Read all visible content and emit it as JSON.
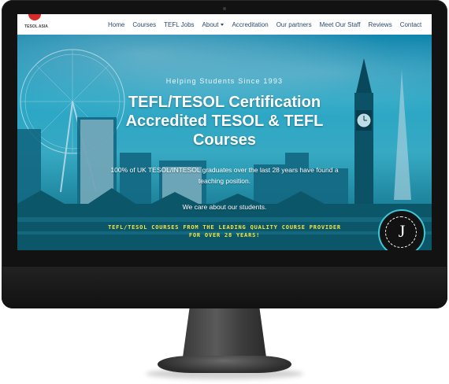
{
  "logo": {
    "text": "TESOL ASIA"
  },
  "nav": {
    "items": [
      "Home",
      "Courses",
      "TEFL Jobs",
      "About",
      "Accreditation",
      "Our partners",
      "Meet Our Staff",
      "Reviews",
      "Contact"
    ]
  },
  "hero": {
    "tagline": "Helping Students Since 1993",
    "title_line1": "TEFL/TESOL Certification",
    "title_line2": "Accredited TESOL & TEFL",
    "title_line3": "Courses",
    "description": "100% of UK TESOL/INTESOL graduates over the last 28 years have found a teaching position.",
    "care": "We care about our students.",
    "promo_line1": "TEFL/TESOL COURSES FROM THE LEADING QUALITY COURSE PROVIDER",
    "promo_line2": "FOR OVER 28 YEARS!"
  },
  "badge": {
    "letter": "J"
  },
  "colors": {
    "nav_text": "#2b4a6e",
    "promo": "#f4e642",
    "logo_red": "#d62b2b"
  }
}
